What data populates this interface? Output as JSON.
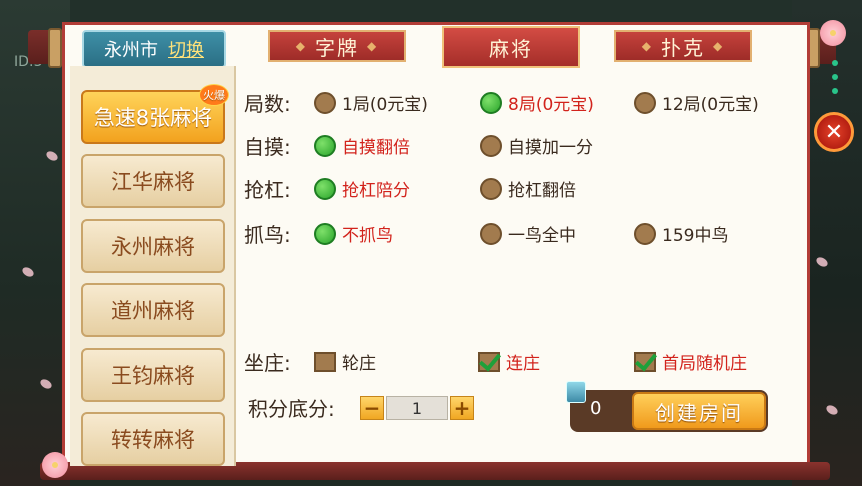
{
  "background": {
    "id_text": "ID:3"
  },
  "header": {
    "city": "永州市",
    "switch_label": "切换",
    "tabs": [
      {
        "label": "字牌",
        "active": false
      },
      {
        "label": "麻将",
        "active": true
      },
      {
        "label": "扑克",
        "active": false
      }
    ]
  },
  "sidebar": {
    "items": [
      {
        "label": "急速8张麻将",
        "active": true,
        "badge": "火爆"
      },
      {
        "label": "江华麻将",
        "active": false
      },
      {
        "label": "永州麻将",
        "active": false
      },
      {
        "label": "道州麻将",
        "active": false
      },
      {
        "label": "王钧麻将",
        "active": false
      },
      {
        "label": "转转麻将",
        "active": false
      }
    ]
  },
  "options": {
    "rounds": {
      "label": "局数:",
      "choices": [
        {
          "text": "1局(0元宝)",
          "selected": false
        },
        {
          "text": "8局(0元宝)",
          "selected": true
        },
        {
          "text": "12局(0元宝)",
          "selected": false
        }
      ]
    },
    "zimo": {
      "label": "自摸:",
      "choices": [
        {
          "text": "自摸翻倍",
          "selected": true
        },
        {
          "text": "自摸加一分",
          "selected": false
        }
      ]
    },
    "qianggang": {
      "label": "抢杠:",
      "choices": [
        {
          "text": "抢杠陪分",
          "selected": true
        },
        {
          "text": "抢杠翻倍",
          "selected": false
        }
      ]
    },
    "zhuaniao": {
      "label": "抓鸟:",
      "choices": [
        {
          "text": "不抓鸟",
          "selected": true
        },
        {
          "text": "一鸟全中",
          "selected": false
        },
        {
          "text": "159中鸟",
          "selected": false
        }
      ]
    },
    "zuozhuang": {
      "label": "坐庄:",
      "choices": [
        {
          "text": "轮庄",
          "checked": false
        },
        {
          "text": "连庄",
          "checked": true
        },
        {
          "text": "首局随机庄",
          "checked": true
        }
      ]
    },
    "base_score": {
      "label": "积分底分:",
      "value": "1",
      "minus": "−",
      "plus": "+"
    }
  },
  "create": {
    "diamond_count": "0",
    "button_label": "创建房间"
  },
  "close_label": "✕",
  "colors": {
    "selected_text": "#d2231c",
    "tab_red": "#b23c36",
    "button_orange": "#f09a1c"
  }
}
